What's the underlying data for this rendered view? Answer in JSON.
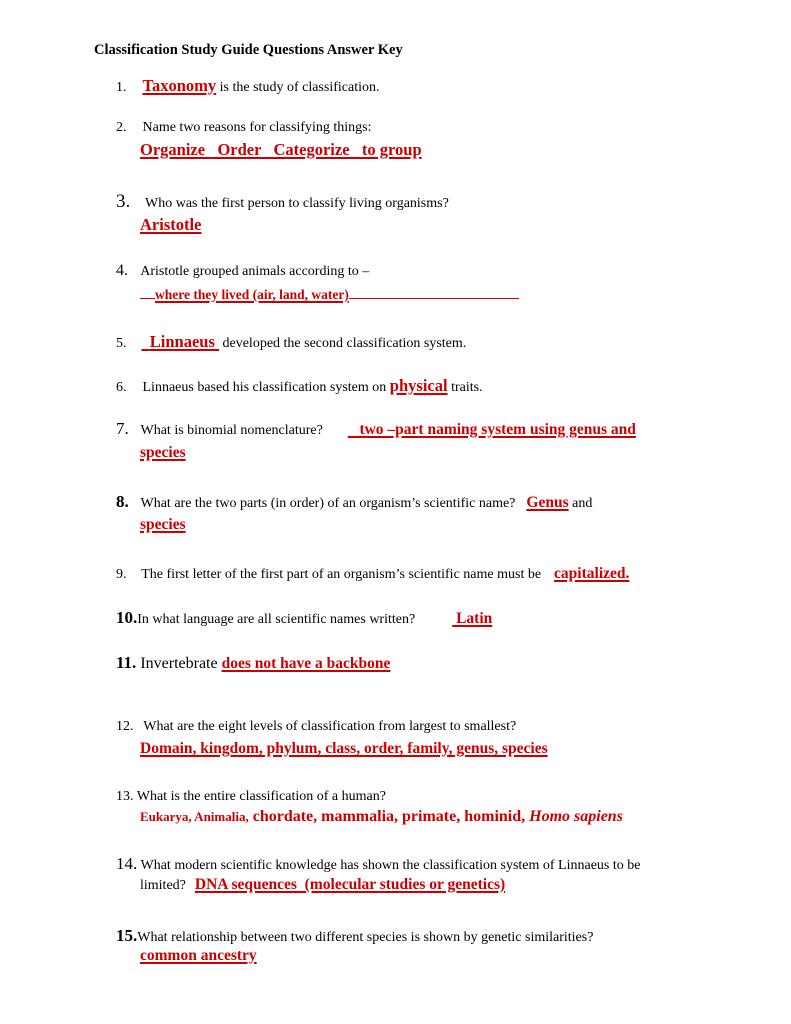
{
  "document": {
    "title": "Classification Study Guide Questions Answer Key",
    "accent_color": "#cc0000",
    "questions": [
      {
        "number": "1.",
        "answer": "Taxonomy",
        "text_after": "is the study of classification."
      },
      {
        "number": "2.",
        "text": "Name two reasons for classifying things:",
        "answer": "Organize   Order   Categorize   to group"
      },
      {
        "number": "3.",
        "text": "Who was the first person to classify living organisms?",
        "answer": "Aristotle"
      },
      {
        "number": "4.",
        "text": "Aristotle grouped animals according to –",
        "answer": "where they lived (air, land, water)"
      },
      {
        "number": "5.",
        "answer": "Linnaeus",
        "text_after": "developed the second classification system."
      },
      {
        "number": "6.",
        "text": "Linnaeus based his classification system on",
        "answer": "physical",
        "text_after": "traits."
      },
      {
        "number": "7.",
        "text": "What is binomial nomenclature?",
        "answer": "two –part naming system using genus and",
        "answer_cont": "species"
      },
      {
        "number": "8.",
        "text": "What are the two parts (in order) of an organism’s scientific name?",
        "answer": "Genus",
        "text_mid": "and",
        "answer_cont": "species"
      },
      {
        "number": "9.",
        "text": "The first letter of the first part of an organism’s scientific name must be",
        "answer": "capitalized."
      },
      {
        "number": "10.",
        "text": "In what language are all scientific names written?",
        "answer": "Latin"
      },
      {
        "number": "11.",
        "text": "Invertebrate",
        "answer": "does not have a backbone"
      },
      {
        "number": "12.",
        "text": "What are the eight levels of classification from largest to smallest?",
        "answer": "Domain, kingdom, phylum, class, order, family, genus, species"
      },
      {
        "number": "13.",
        "text": "What is the entire classification of a human?",
        "answer_small": "Eukarya, Animalia,",
        "answer": "chordate, mammalia, primate, hominid,",
        "answer_italic": "Homo sapiens"
      },
      {
        "number": "14.",
        "text": "What modern scientific knowledge has shown the classification system of Linnaeus to be",
        "text_cont": "limited?",
        "answer": "DNA sequences  (molecular studies or genetics)"
      },
      {
        "number": "15.",
        "text": "What relationship between two different species is shown by genetic similarities?",
        "answer": "common ancestry"
      }
    ]
  }
}
